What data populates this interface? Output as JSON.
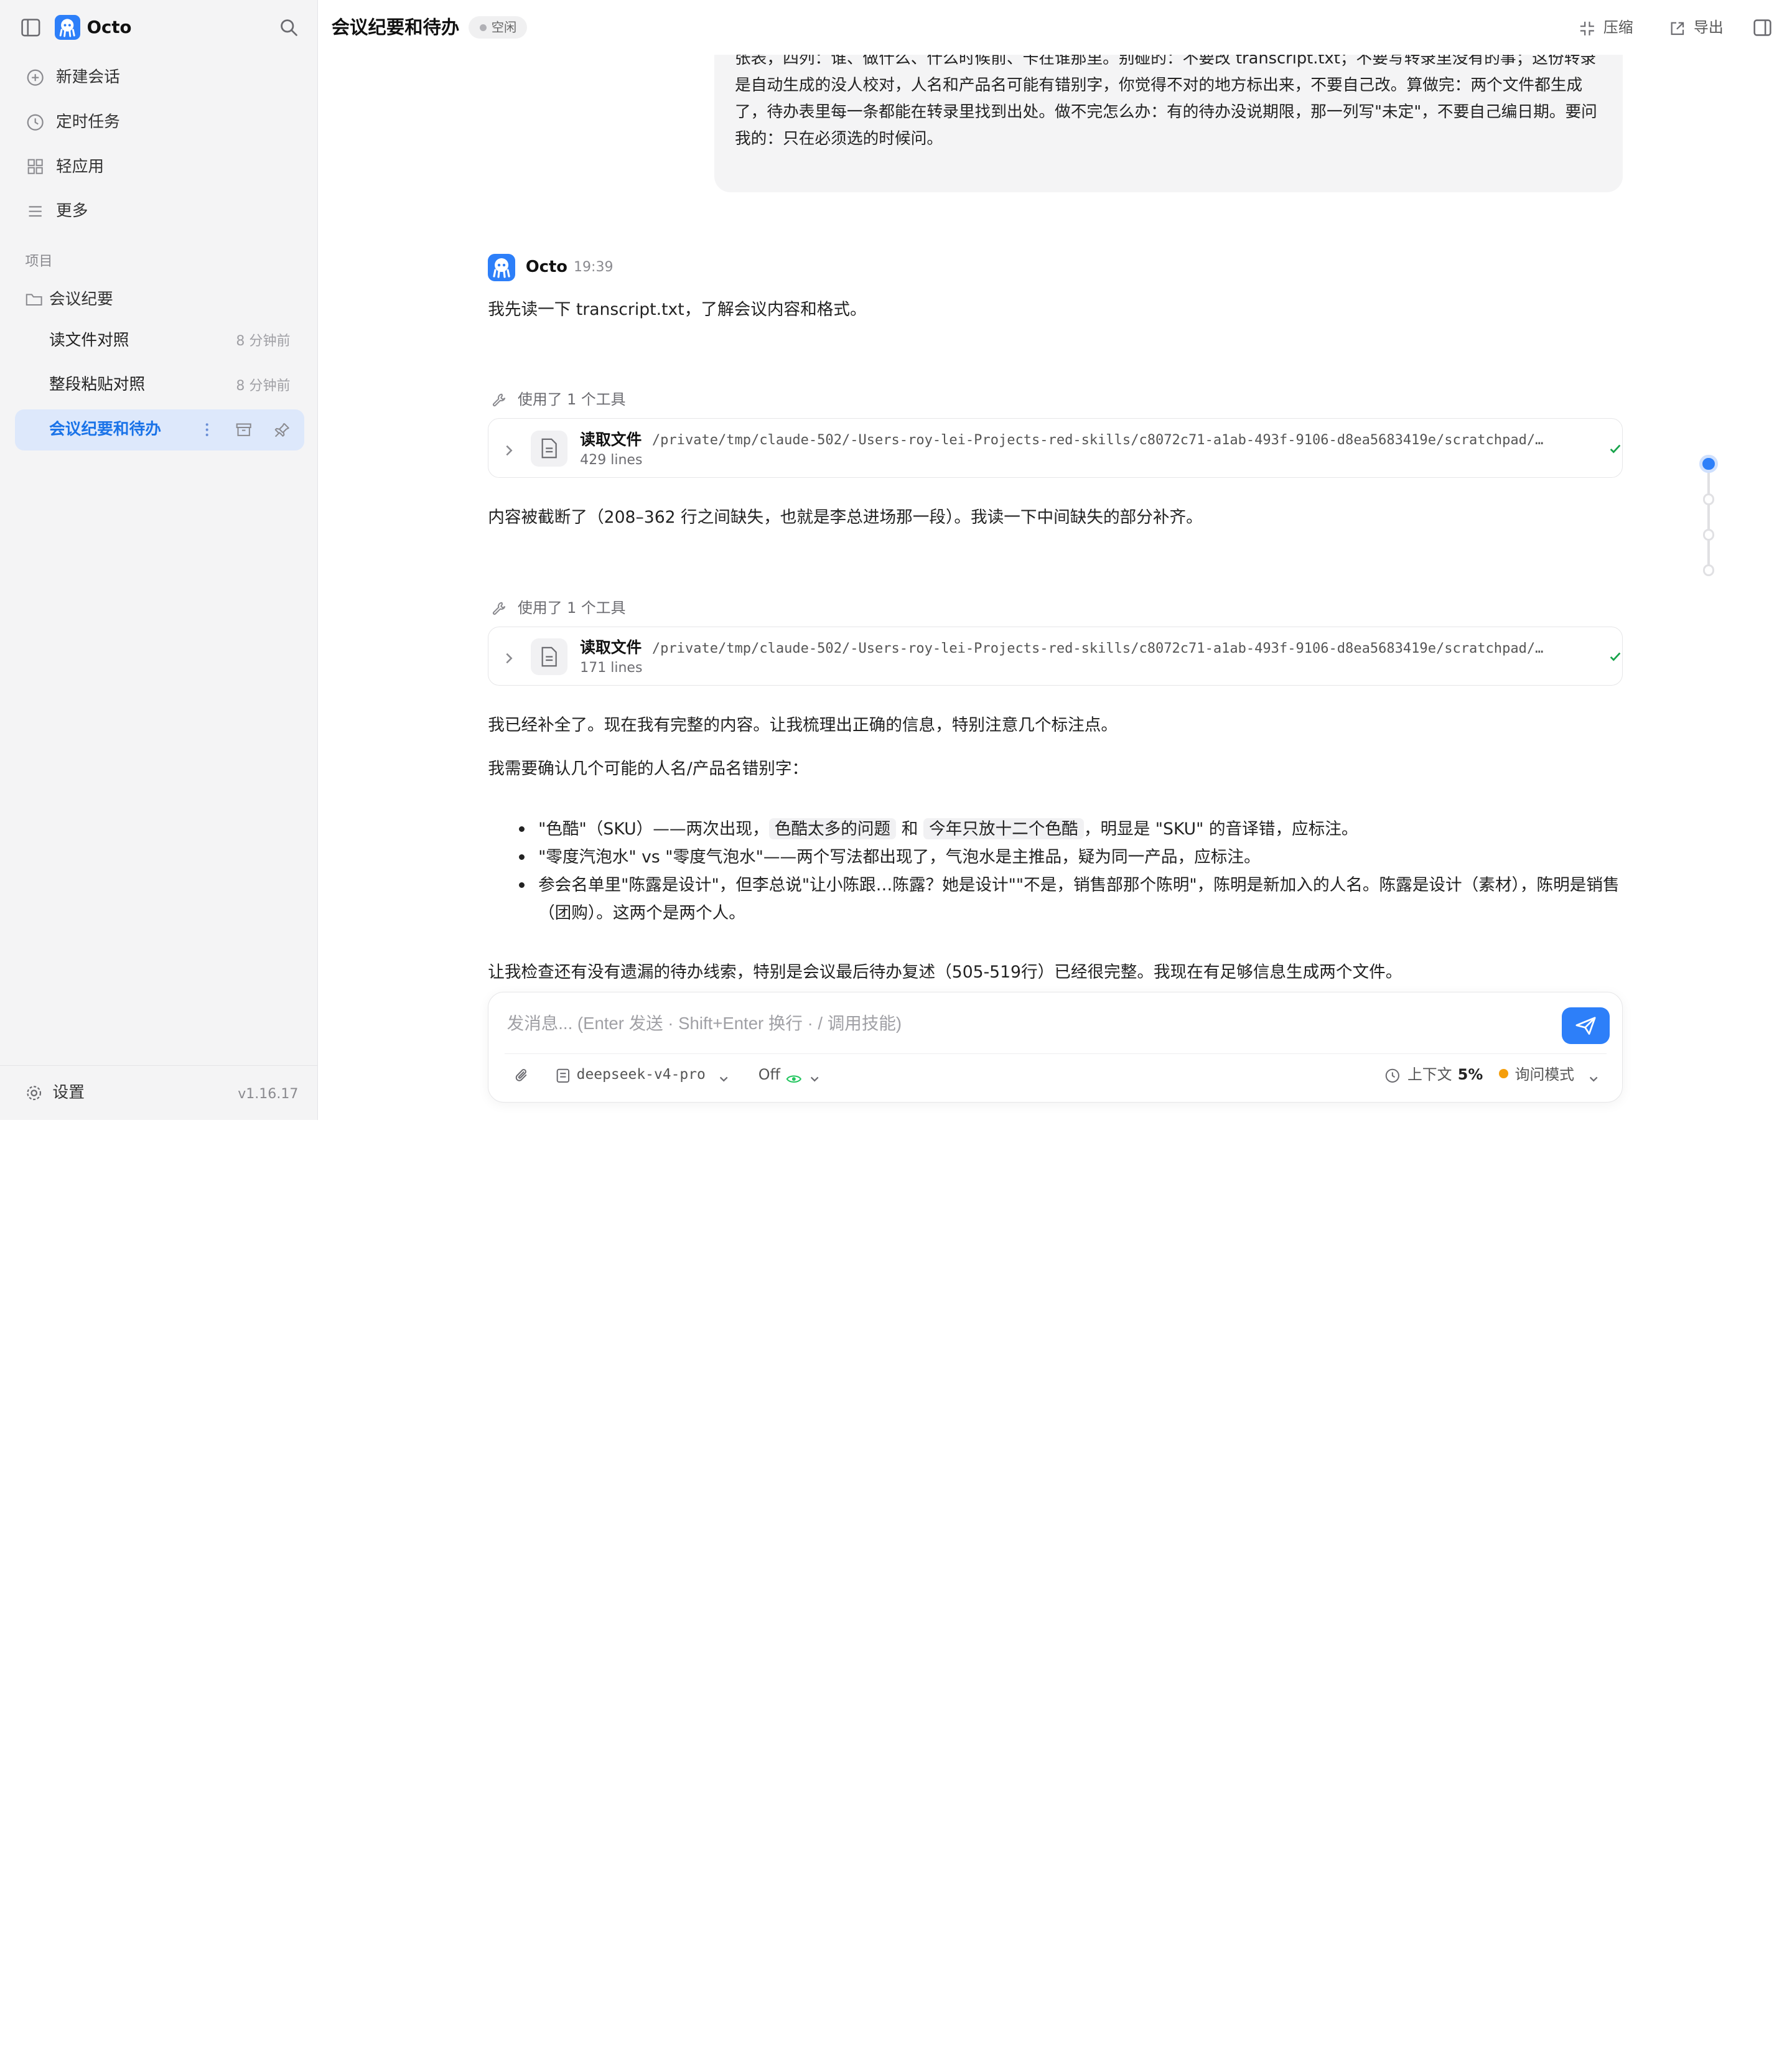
{
  "app": {
    "name": "Octo",
    "version": "v1.16.17"
  },
  "sidebar": {
    "nav": [
      {
        "label": "新建会话",
        "icon": "plus-circle-icon"
      },
      {
        "label": "定时任务",
        "icon": "clock-icon"
      },
      {
        "label": "轻应用",
        "icon": "grid-icon"
      },
      {
        "label": "更多",
        "icon": "menu-icon"
      }
    ],
    "section_label": "项目",
    "folder": "会议纪要",
    "sessions": [
      {
        "label": "读文件对照",
        "time": "8 分钟前"
      },
      {
        "label": "整段粘贴对照",
        "time": "8 分钟前"
      },
      {
        "label": "会议纪要和待办",
        "time": ""
      }
    ],
    "settings_label": "设置"
  },
  "header": {
    "title": "会议纪要和待办",
    "status": "空闲",
    "compress_label": "压缩",
    "export_label": "导出"
  },
  "chat": {
    "user_message": "个文件夹生成两个文件，会议纪要.md 和 待办清单.md，纪要按议题分节，每节最后一行写这一节的结论；待办清单是一张表，四列：谁、做什么、什么时候前、卡在谁那里。别碰的：不要改 transcript.txt；不要写转录里没有的事；这份转录是自动生成的没人校对，人名和产品名可能有错别字，你觉得不对的地方标出来，不要自己改。算做完：两个文件都生成了，待办表里每一条都能在转录里找到出处。做不完怎么办：有的待办没说期限，那一列写\"未定\"，不要自己编日期。要问我的：只在必须选的时候问。",
    "assistant_name": "Octo",
    "assistant_time": "19:39",
    "p1": "我先读一下 transcript.txt，了解会议内容和格式。",
    "tool_used_1": "使用了 1 个工具",
    "tool1": {
      "name": "读取文件",
      "path": "/private/tmp/claude-502/-Users-roy-lei-Projects-red-skills/c8072c71-a1ab-493f-9106-d8ea5683419e/scratchpad/transcript.txt",
      "lines": "429 lines",
      "status": "完成"
    },
    "p2": "内容被截断了（208–362 行之间缺失，也就是李总进场那一段）。我读一下中间缺失的部分补齐。",
    "tool_used_2": "使用了 1 个工具",
    "tool2": {
      "name": "读取文件",
      "path": "/private/tmp/claude-502/-Users-roy-lei-Projects-red-skills/c8072c71-a1ab-493f-9106-d8ea5683419e/scratchpad/transcript.txt",
      "lines": "171 lines",
      "status": "完成"
    },
    "p3": "我已经补全了。现在我有完整的内容。让我梳理出正确的信息，特别注意几个标注点。",
    "p4": "我需要确认几个可能的人名/产品名错别字：",
    "b1": {
      "a": "\"色酷\"（SKU）——两次出现，",
      "c1": "色酷太多的问题",
      "m": " 和 ",
      "c2": "今年只放十二个色酷",
      "b": "，明显是 \"SKU\" 的音译错，应标注。"
    },
    "b2": "\"零度汽泡水\" vs \"零度气泡水\"——两个写法都出现了，气泡水是主推品，疑为同一产品，应标注。",
    "b3": "参会名单里\"陈露是设计\"，但李总说\"让小陈跟…陈露？她是设计\"\"不是，销售部那个陈明\"，陈明是新加入的人名。陈露是设计（素材），陈明是销售（团购）。这两个是两个人。",
    "p5": "让我检查还有没有遗漏的待办线索，特别是会议最后待办复述（505-519行）已经很完整。我现在有足够信息生成两个文件。"
  },
  "composer": {
    "placeholder": "发消息... (Enter 发送 · Shift+Enter 换行 · / 调用技能)",
    "model": "deepseek-v4-pro",
    "thinking": "Off",
    "context_label": "上下文",
    "context_value": "5%",
    "mode": "询问模式"
  },
  "colors": {
    "accent": "#2d7ff9",
    "success": "#16a34a",
    "mode_dot": "#f59e0b"
  }
}
